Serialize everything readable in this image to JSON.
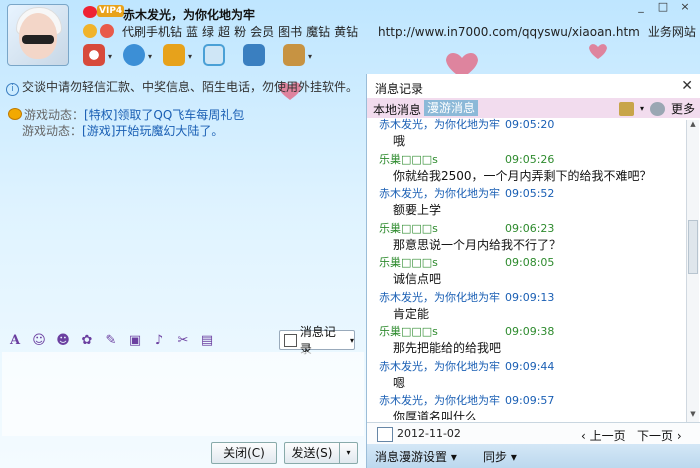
{
  "header": {
    "nickname": "赤木发光，为你化地为牢",
    "vip_label": "VIP4",
    "sub_links": [
      "代刷手机钻",
      "蓝",
      "绿",
      "超",
      "粉",
      "会员",
      "图书",
      "魔钻",
      "黄钻"
    ],
    "url": "http://www.in7000.com/qqyswu/xiaoan.htm",
    "url_suffix": "业务网站"
  },
  "window_controls": [
    "_",
    "□",
    "×"
  ],
  "toolbar": {
    "icons": [
      "video-icon",
      "voice-icon",
      "file-transfer-icon",
      "screen-share-icon",
      "app-icon",
      "remote-desktop-icon",
      "more-apps-icon"
    ],
    "colors": [
      "#d74a3b",
      "#3c8fd6",
      "#e7a21b",
      "#4aa0d6",
      "#66b23f",
      "#3a7fc0",
      "#c79342"
    ]
  },
  "left": {
    "notice": "交谈中请勿轻信汇款、中奖信息、陌生电话，勿使用外挂软件。",
    "game_lines": [
      {
        "label": "游戏动态：",
        "link": "[特权]领取了QQ飞车每周礼包"
      },
      {
        "label": "游戏动态：",
        "link": "[游戏]开始玩魔幻大陆了。"
      }
    ],
    "format_icons": [
      "font-icon",
      "emoji-icon",
      "face-icon",
      "sticker-icon",
      "handwrite-icon",
      "image-icon",
      "music-icon",
      "screenshot-icon",
      "more-icon"
    ],
    "history_btn": "消息记录",
    "close_btn": "关闭(C)",
    "send_btn": "发送(S)"
  },
  "right": {
    "title": "消息记录",
    "tab_local": "本地消息",
    "tab_roam": "漫游消息",
    "more": "更多",
    "sender_color": "#1a5fb4",
    "friend_color": "#2e8b2e",
    "messages": [
      {
        "sender": "赤木发光，为你化地为牢",
        "time": "09:05:20",
        "text": "哦",
        "self": true
      },
      {
        "sender": "乐巢□□□s",
        "time": "09:05:26",
        "text": "你就给我2500，一个月内弄剩下的给我不难吧？",
        "self": false
      },
      {
        "sender": "赤木发光，为你化地为牢",
        "time": "09:05:52",
        "text": "额要上学",
        "self": true
      },
      {
        "sender": "乐巢□□□s",
        "time": "09:06:23",
        "text": "那意思说一个月内给我不行了？",
        "self": false
      },
      {
        "sender": "乐巢□□□s",
        "time": "09:08:05",
        "text": "诚信点吧",
        "self": false
      },
      {
        "sender": "赤木发光，为你化地为牢",
        "time": "09:09:13",
        "text": "肯定能",
        "self": true
      },
      {
        "sender": "乐巢□□□s",
        "time": "09:09:38",
        "text": "那先把能给的给我吧",
        "self": false
      },
      {
        "sender": "赤木发光，为你化地为牢",
        "time": "09:09:44",
        "text": "嗯",
        "self": true
      },
      {
        "sender": "赤木发光，为你化地为牢",
        "time": "09:09:57",
        "text": "你厚道名叫什么",
        "self": true
      }
    ],
    "date": "2012-11-02",
    "prev": "上一页",
    "next": "下一页",
    "settings": "消息漫游设置",
    "sync": "同步"
  }
}
